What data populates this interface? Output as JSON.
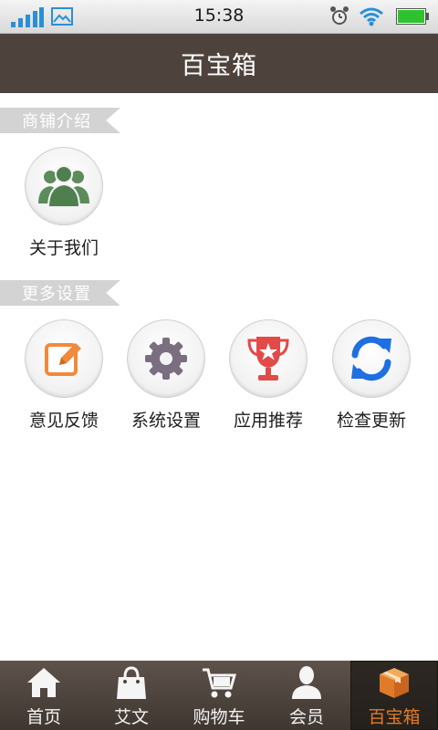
{
  "status_bar": {
    "time": "15:38"
  },
  "header": {
    "title": "百宝箱"
  },
  "sections": [
    {
      "title": "商铺介绍",
      "items": [
        {
          "label": "关于我们",
          "icon": "people-icon"
        }
      ]
    },
    {
      "title": "更多设置",
      "items": [
        {
          "label": "意见反馈",
          "icon": "edit-icon"
        },
        {
          "label": "系统设置",
          "icon": "gear-icon"
        },
        {
          "label": "应用推荐",
          "icon": "trophy-icon"
        },
        {
          "label": "检查更新",
          "icon": "refresh-icon"
        }
      ]
    }
  ],
  "tabs": [
    {
      "label": "首页",
      "icon": "home-icon"
    },
    {
      "label": "艾文",
      "icon": "bag-icon"
    },
    {
      "label": "购物车",
      "icon": "cart-icon"
    },
    {
      "label": "会员",
      "icon": "member-icon"
    },
    {
      "label": "百宝箱",
      "icon": "box-icon",
      "active": true
    }
  ],
  "colors": {
    "header_bg": "#4e433c",
    "tab_bar_bg": "#4e433c",
    "active_tab_text": "#e07b2a",
    "section_tag_bg": "#d3d3d3",
    "people_icon": "#5b8c5a",
    "edit_icon": "#f08a3c",
    "gear_icon": "#7a6e80",
    "trophy_icon": "#e24a4a",
    "refresh_icon": "#1f6fe0"
  }
}
